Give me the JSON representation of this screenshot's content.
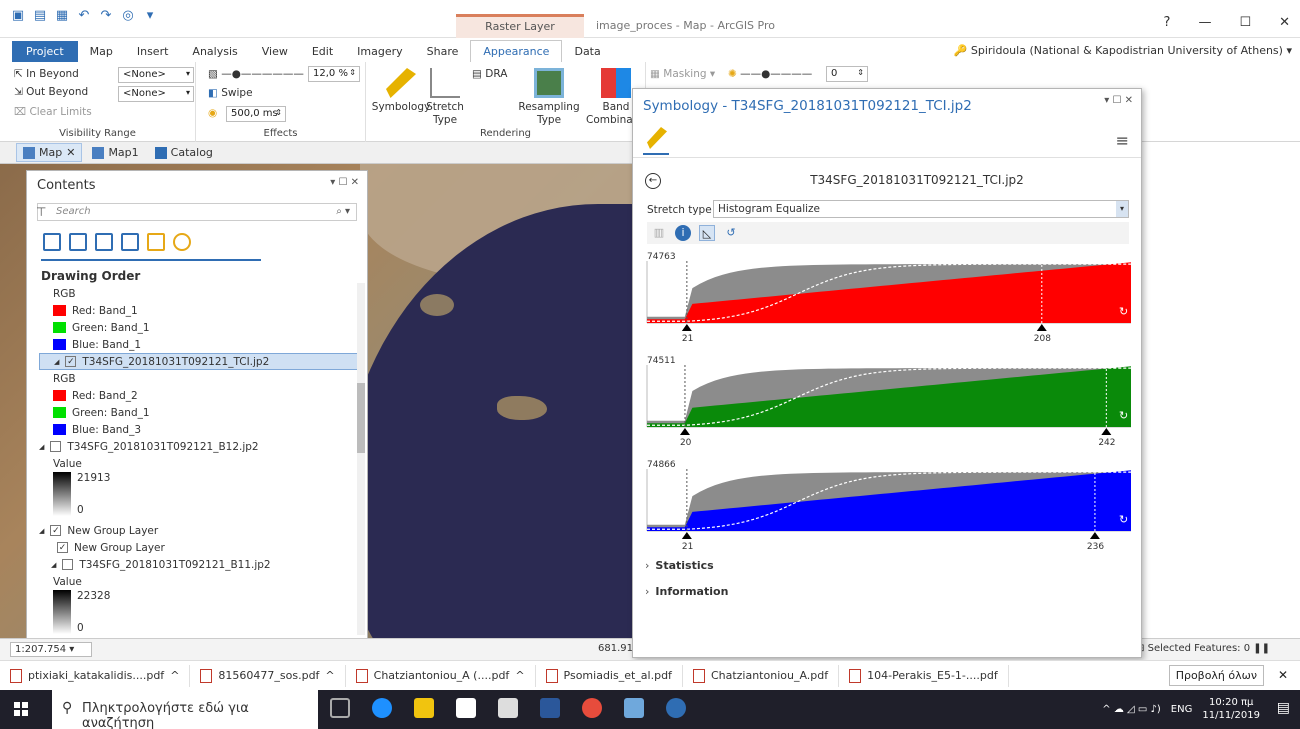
{
  "titlebar": {
    "context_tab": "Raster Layer",
    "window_title": "image_proces - Map - ArcGIS Pro",
    "help": "?",
    "minimize": "—",
    "maximize": "☐",
    "close": "✕"
  },
  "tabs": [
    "Project",
    "Map",
    "Insert",
    "Analysis",
    "View",
    "Edit",
    "Imagery",
    "Share",
    "Appearance",
    "Data"
  ],
  "user": "Spiridoula (National & Kapodistrian University of Athens)",
  "ribbon": {
    "in_beyond": "In Beyond",
    "out_beyond": "Out Beyond",
    "clear_limits": "Clear Limits",
    "none1": "<None>",
    "none2": "<None>",
    "visibility_range": "Visibility Range",
    "transparency": "12,0 %",
    "swipe": "Swipe",
    "flicker": "500,0 ms",
    "effects": "Effects",
    "symbology": "Symbology",
    "stretch_type": "Stretch Type",
    "dra": "DRA",
    "resampling_type": "Resampling Type",
    "band_combination": "Band Combination",
    "rendering": "Rendering",
    "masking": "Masking",
    "gamma": "0"
  },
  "viewtabs": [
    "Map",
    "Map1",
    "Catalog"
  ],
  "contents": {
    "title": "Contents",
    "search_placeholder": "Search",
    "drawing_order": "Drawing Order",
    "rows": [
      {
        "kind": "header",
        "text": "RGB"
      },
      {
        "kind": "band",
        "color": "#ff0000",
        "text": "Red:  Band_1"
      },
      {
        "kind": "band",
        "color": "#00e000",
        "text": "Green: Band_1"
      },
      {
        "kind": "band",
        "color": "#0000ff",
        "text": "Blue:  Band_1"
      },
      {
        "kind": "layer",
        "checked": true,
        "selected": true,
        "text": "T34SFG_20181031T092121_TCI.jp2"
      },
      {
        "kind": "header",
        "text": "RGB"
      },
      {
        "kind": "band",
        "color": "#ff0000",
        "text": "Red:  Band_2"
      },
      {
        "kind": "band",
        "color": "#00e000",
        "text": "Green: Band_1"
      },
      {
        "kind": "band",
        "color": "#0000ff",
        "text": "Blue:  Band_3"
      },
      {
        "kind": "layer",
        "checked": false,
        "text": "T34SFG_20181031T092121_B12.jp2"
      },
      {
        "kind": "header",
        "text": "Value"
      },
      {
        "kind": "ramp",
        "high": "21913",
        "low": "0"
      },
      {
        "kind": "layer",
        "checked": true,
        "text": "New Group Layer"
      },
      {
        "kind": "sublayer",
        "checked": true,
        "text": "New Group Layer"
      },
      {
        "kind": "layer2",
        "checked": false,
        "text": "T34SFG_20181031T092121_B11.jp2"
      },
      {
        "kind": "header",
        "text": "Value"
      },
      {
        "kind": "ramp",
        "high": "22328",
        "low": "0"
      }
    ]
  },
  "statusbar": {
    "scale": "1:207.754",
    "coords": "681.914,",
    "selected_features": "Selected Features: 0"
  },
  "symbology": {
    "title": "Symbology - T34SFG_20181031T092121_TCI.jp2",
    "layer_name": "T34SFG_20181031T092121_TCI.jp2",
    "stretch_type_label": "Stretch type",
    "stretch_type_value": "Histogram Equalize",
    "statistics": "Statistics",
    "information": "Information"
  },
  "chart_data": [
    {
      "type": "area",
      "title": "",
      "band": "red",
      "color": "#ff0000",
      "max_count": 74763,
      "min_label": "21",
      "max_label": "208",
      "min_value": 21,
      "max_value": 208,
      "xlim": [
        0,
        255
      ]
    },
    {
      "type": "area",
      "title": "",
      "band": "green",
      "color": "#0a8a0a",
      "max_count": 74511,
      "min_label": "20",
      "max_label": "242",
      "min_value": 20,
      "max_value": 242,
      "xlim": [
        0,
        255
      ]
    },
    {
      "type": "area",
      "title": "",
      "band": "blue",
      "color": "#0000ff",
      "max_count": 74866,
      "min_label": "21",
      "max_label": "236",
      "min_value": 21,
      "max_value": 236,
      "xlim": [
        0,
        255
      ]
    }
  ],
  "downloads": [
    "ptixiaki_katakalidis....pdf",
    "81560477_sos.pdf",
    "Chatziantoniou_A (....pdf",
    "Psomiadis_et_al.pdf",
    "Chatziantoniou_A.pdf",
    "104-Perakis_E5-1-....pdf"
  ],
  "show_all": "Προβολή όλων",
  "taskbar": {
    "search_placeholder": "Πληκτρολογήστε εδώ για αναζήτηση",
    "lang": "ENG",
    "time": "10:20 πμ",
    "date": "11/11/2019"
  }
}
